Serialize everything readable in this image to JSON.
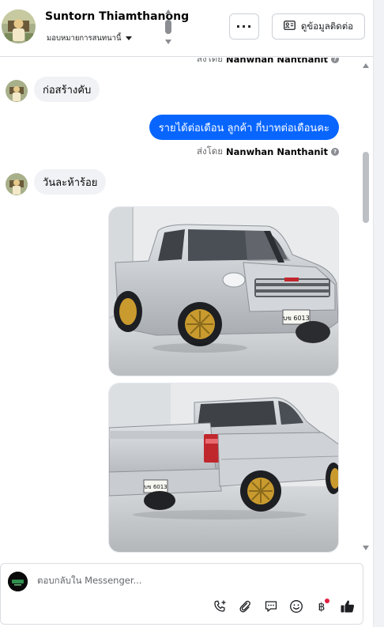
{
  "header": {
    "contact_name": "Suntorn Thiamthanong",
    "assign_label": "มอบหมายการสนทนานี้",
    "more_label": "···",
    "info_button_label": "ดูข้อมูลติดต่อ"
  },
  "thread": {
    "messages": [
      {
        "direction": "outgoing",
        "sent_by_prefix": "ส่งโดย",
        "sent_by_name": "Nanwhan Nanthanit"
      },
      {
        "direction": "incoming",
        "text": "ก่อสร้างคับ"
      },
      {
        "direction": "outgoing",
        "text": "รายได้ต่อเดือน ลูกค้า กี่บาทต่อเดือนคะ",
        "sent_by_prefix": "ส่งโดย",
        "sent_by_name": "Nanwhan Nanthanit"
      },
      {
        "direction": "incoming",
        "text": "วันละห้าร้อย"
      },
      {
        "direction": "incoming",
        "attachment": "photo",
        "subject": "silver pickup truck front three-quarter view"
      },
      {
        "direction": "incoming",
        "attachment": "photo",
        "subject": "silver pickup truck rear three-quarter view"
      }
    ],
    "plate_text": "บข 6013"
  },
  "composer": {
    "placeholder": "ตอบกลับใน Messenger...",
    "tools": [
      "phone-add-icon",
      "paperclip-icon",
      "chat-bubble-icon",
      "emoji-icon",
      "baht-icon",
      "thumbs-up-icon"
    ]
  },
  "colors": {
    "accent": "#0866ff",
    "incoming_bubble": "#f0f2f5",
    "muted_text": "#65676b",
    "notification_dot": "#e41e3f",
    "truck_silver": "#c8ccd0",
    "wheel_gold": "#c99a2e"
  }
}
